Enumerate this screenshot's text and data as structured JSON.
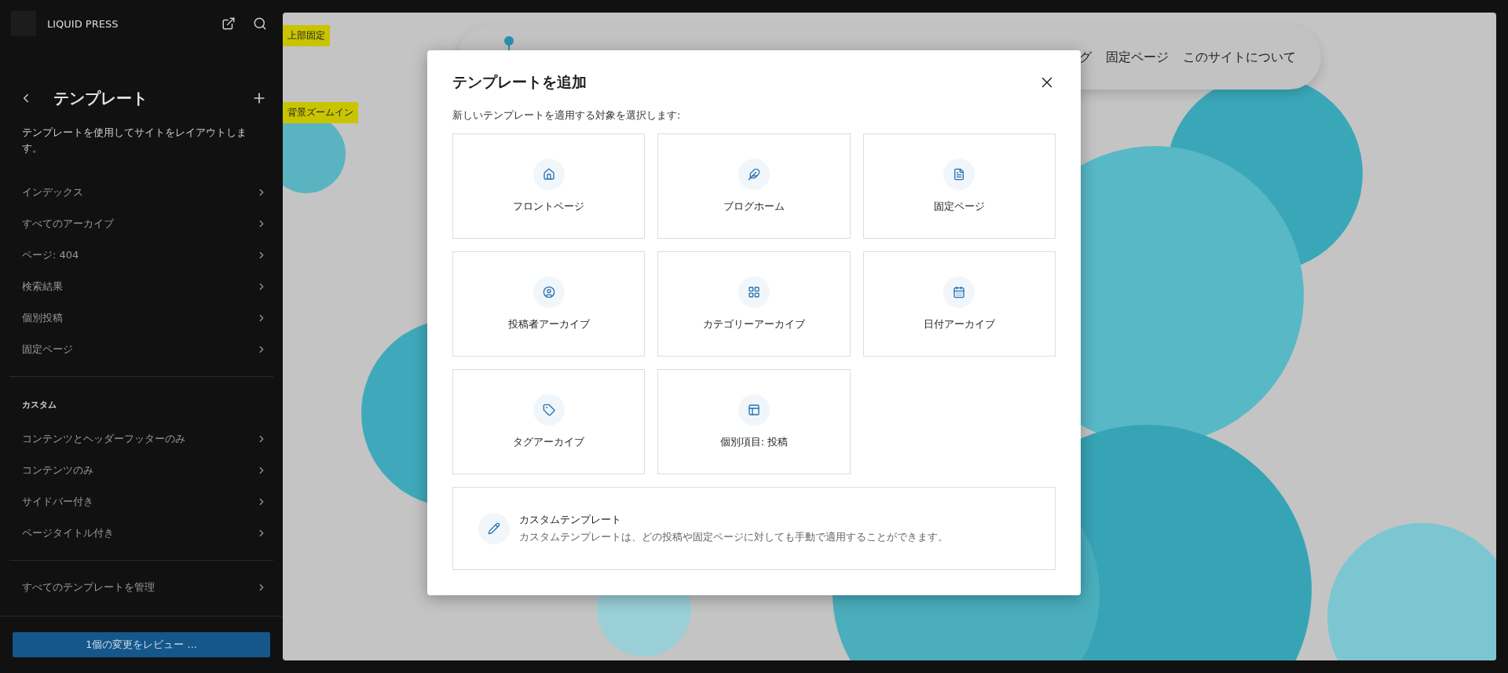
{
  "sidebar": {
    "site_title": "LIQUID PRESS",
    "heading": "テンプレート",
    "description": "テンプレートを使用してサイトをレイアウトします。",
    "items": [
      "インデックス",
      "すべてのアーカイブ",
      "ページ: 404",
      "検索結果",
      "個別投稿",
      "固定ページ"
    ],
    "section_title": "カスタム",
    "custom_items": [
      "コンテンツとヘッダーフッターのみ",
      "コンテンツのみ",
      "サイドバー付き",
      "ページタイトル付き"
    ],
    "manage_link": "すべてのテンプレートを管理",
    "review_button": "1個の変更をレビュー ..."
  },
  "preview": {
    "labels": [
      "上部固定",
      "背景ズームイン"
    ],
    "nav": [
      "グ",
      "固定ページ",
      "このサイトについて"
    ]
  },
  "dialog": {
    "title": "テンプレートを追加",
    "subtitle": "新しいテンプレートを適用する対象を選択します:",
    "options": [
      {
        "label": "フロントページ"
      },
      {
        "label": "ブログホーム"
      },
      {
        "label": "固定ページ"
      },
      {
        "label": "投稿者アーカイブ"
      },
      {
        "label": "カテゴリーアーカイブ"
      },
      {
        "label": "日付アーカイブ"
      },
      {
        "label": "タグアーカイブ"
      },
      {
        "label": "個別項目: 投稿"
      }
    ],
    "custom": {
      "title": "カスタムテンプレート",
      "description": "カスタムテンプレートは、どの投稿や固定ページに対しても手動で適用することができます。"
    }
  }
}
